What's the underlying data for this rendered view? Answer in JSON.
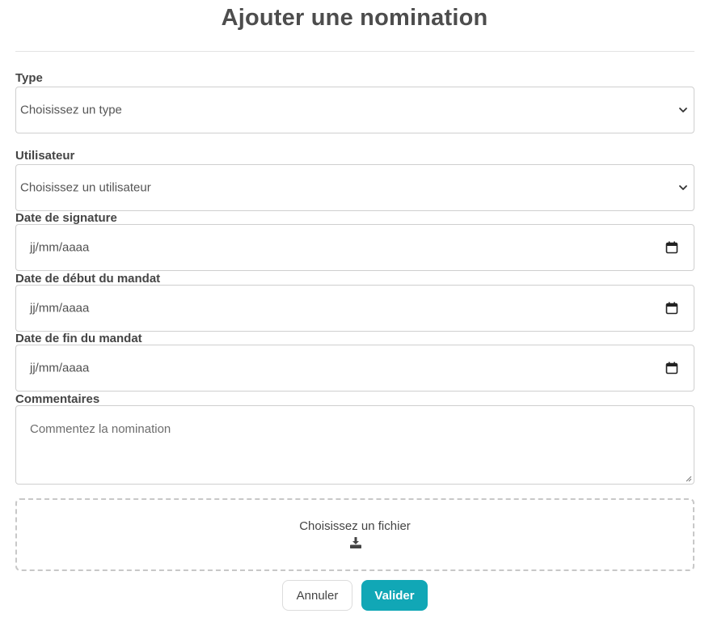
{
  "page": {
    "title": "Ajouter une nomination"
  },
  "form": {
    "type": {
      "label": "Type",
      "value": "Choisissez un type"
    },
    "user": {
      "label": "Utilisateur",
      "value": "Choisissez un utilisateur"
    },
    "signature_date": {
      "label": "Date de signature",
      "value": "jj/mm/aaaa"
    },
    "start_date": {
      "label": "Date de début du mandat",
      "value": "jj/mm/aaaa"
    },
    "end_date": {
      "label": "Date de fin du mandat",
      "value": "jj/mm/aaaa"
    },
    "comments": {
      "label": "Commentaires",
      "placeholder": "Commentez la nomination"
    },
    "file": {
      "label": "Choisissez un fichier",
      "icon": "download-icon"
    }
  },
  "actions": {
    "cancel_label": "Annuler",
    "submit_label": "Valider"
  },
  "colors": {
    "accent": "#11a7b6",
    "text": "#4a4a4a",
    "border": "#cfcfcf"
  }
}
